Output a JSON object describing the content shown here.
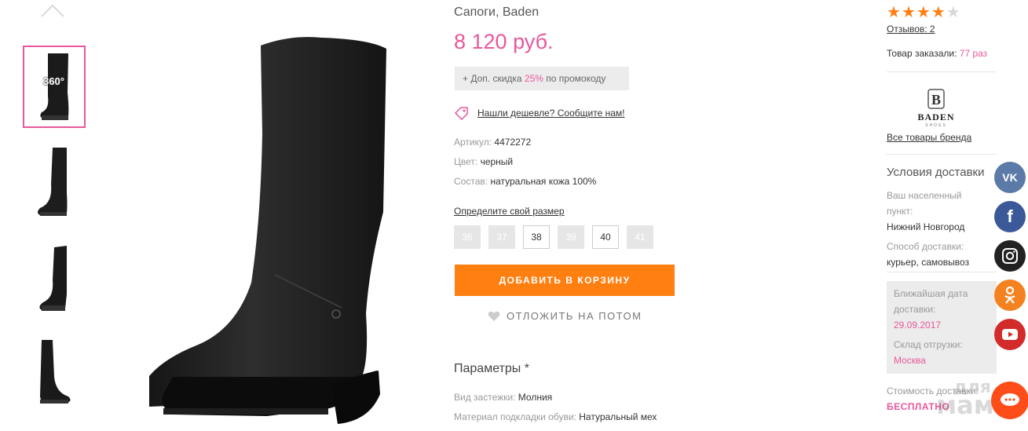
{
  "product": {
    "title": "Сапоги, Baden",
    "price": "8 120 руб.",
    "promo_prefix": "+ Доп. скидка ",
    "promo_percent": "25%",
    "promo_suffix": " по промокоду",
    "cheaper_text": "Нашли дешевле? Сообщите нам!",
    "attributes": [
      {
        "label": "Артикул:",
        "value": "4472272"
      },
      {
        "label": "Цвет:",
        "value": "черный"
      },
      {
        "label": "Состав:",
        "value": "натуральная кожа 100%"
      }
    ],
    "size_link": "Определите свой размер",
    "sizes": [
      {
        "label": "36",
        "available": false
      },
      {
        "label": "37",
        "available": false
      },
      {
        "label": "38",
        "available": true
      },
      {
        "label": "39",
        "available": false
      },
      {
        "label": "40",
        "available": true
      },
      {
        "label": "41",
        "available": false
      }
    ],
    "add_to_cart": "ДОБАВИТЬ В КОРЗИНУ",
    "save_later": "ОТЛОЖИТЬ НА ПОТОМ",
    "params_heading": "Параметры *",
    "params": [
      {
        "label": "Вид застежки:",
        "value": "Молния"
      },
      {
        "label": "Материал подкладки обуви:",
        "value": "Натуральный мех"
      }
    ]
  },
  "thumbnails": {
    "badge": "360°"
  },
  "sidebar": {
    "rating": 4,
    "rating_max": 5,
    "reviews_link": "Отзывов: 2",
    "ordered_label": "Товар заказали: ",
    "ordered_count": "77 раз",
    "brand_name": "BADEN",
    "brand_sub": "SHOES",
    "brand_link": "Все товары бренда",
    "delivery_heading": "Условия доставки",
    "locality_label_1": "Ваш населенный",
    "locality_label_2": "пункт:",
    "locality_value": "Нижний Новгород",
    "method_label": "Способ доставки:",
    "method_value": "курьер, самовывоз",
    "nearest_label_1": "Ближайшая дата",
    "nearest_label_2": "доставки:",
    "nearest_date": "29.09.2017",
    "warehouse_label": "Склад отгрузки:",
    "warehouse_value": "Москва",
    "cost_label": "Стоимость доставки:",
    "cost_value": "БЕСПЛАТНО"
  },
  "social": {
    "vk": "vk",
    "fb": "f",
    "colors": {
      "vk": "#5b7aa8",
      "fb": "#3b5998",
      "ig": "#222222",
      "ok": "#f58220",
      "yt": "#d32a2a"
    }
  },
  "watermark": "для\nмам",
  "colors": {
    "accent": "#e8579b",
    "cart": "#ff7f11",
    "star": "#ff7f11"
  }
}
